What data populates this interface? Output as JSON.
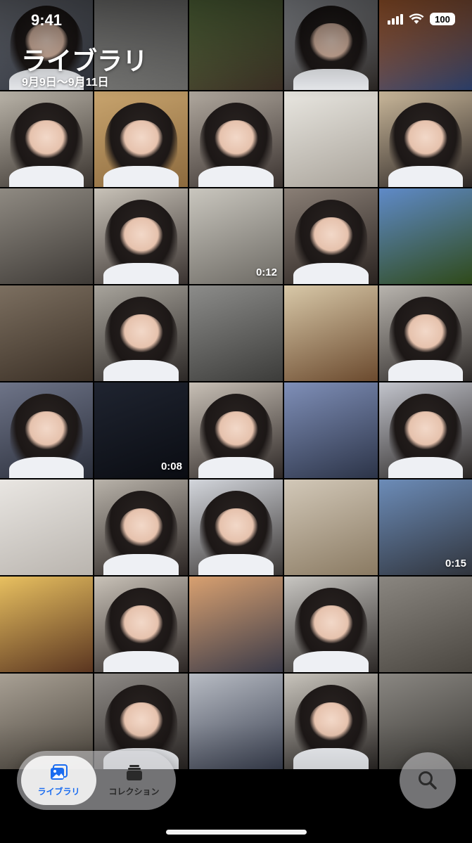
{
  "status_bar": {
    "time": "9:41",
    "battery": "100"
  },
  "header": {
    "title": "ライブラリ",
    "date_range": "9月9日〜9月11日"
  },
  "tiles": [
    {
      "c1": "#8a8f9a",
      "c2": "#2b2f38",
      "p": 1
    },
    {
      "c1": "#9a9a98",
      "c2": "#6b6b69",
      "p": 0
    },
    {
      "c1": "#6f8d4f",
      "c2": "#3b2e24",
      "p": 0
    },
    {
      "c1": "#c7ccd4",
      "c2": "#2a2522",
      "p": 1
    },
    {
      "c1": "#e07a3a",
      "c2": "#2b3f6b",
      "p": 0
    },
    {
      "c1": "#b9b3a8",
      "c2": "#3a342f",
      "p": 1
    },
    {
      "c1": "#c8a46e",
      "c2": "#8c6a3e",
      "p": 1
    },
    {
      "c1": "#b0a89e",
      "c2": "#3b3330",
      "p": 1
    },
    {
      "c1": "#e8e6e0",
      "c2": "#a9a39a",
      "p": 0
    },
    {
      "c1": "#c9b79a",
      "c2": "#2c2624",
      "p": 1
    },
    {
      "c1": "#8f8a82",
      "c2": "#3e3a36",
      "p": 0
    },
    {
      "c1": "#c8c2b8",
      "c2": "#3a3330",
      "p": 1
    },
    {
      "c1": "#c9c6be",
      "c2": "#6d6a64",
      "p": 0
    },
    {
      "c1": "#8a7f76",
      "c2": "#2a2320",
      "p": 1
    },
    {
      "c1": "#5f8ac8",
      "c2": "#2f4a1a",
      "p": 0
    },
    {
      "c1": "#7c6f60",
      "c2": "#3a2f25",
      "p": 0
    },
    {
      "c1": "#a8a49c",
      "c2": "#2c2826",
      "p": 1
    },
    {
      "c1": "#8c8c8a",
      "c2": "#3c3c3a",
      "p": 0
    },
    {
      "c1": "#d8c8a8",
      "c2": "#6b4a2e",
      "p": 0
    },
    {
      "c1": "#b8b4ae",
      "c2": "#2e2a28",
      "p": 1
    },
    {
      "c1": "#6e7488",
      "c2": "#2a2e3a",
      "p": 1
    },
    {
      "c1": "#1f2430",
      "c2": "#0a0c12",
      "p": 0
    },
    {
      "c1": "#c8c0b6",
      "c2": "#2e2826",
      "p": 1
    },
    {
      "c1": "#7f8fb8",
      "c2": "#2c3448",
      "p": 0
    },
    {
      "c1": "#c2c4cc",
      "c2": "#2a2624",
      "p": 1
    },
    {
      "c1": "#e9e6e2",
      "c2": "#b9b4ae",
      "p": 0
    },
    {
      "c1": "#b9b3aa",
      "c2": "#2a2422",
      "p": 1
    },
    {
      "c1": "#d3d6dc",
      "c2": "#3a3634",
      "p": 1
    },
    {
      "c1": "#d2c8b8",
      "c2": "#8a7a62",
      "p": 0
    },
    {
      "c1": "#6c8cb8",
      "c2": "#30343c",
      "p": 0
    },
    {
      "c1": "#e8c060",
      "c2": "#5a3520",
      "p": 0
    },
    {
      "c1": "#c9c2b8",
      "c2": "#2c2624",
      "p": 1
    },
    {
      "c1": "#d8a070",
      "c2": "#3a3a48",
      "p": 0
    },
    {
      "c1": "#c8c6c2",
      "c2": "#2c2826",
      "p": 1
    },
    {
      "c1": "#8a8680",
      "c2": "#4a4640",
      "p": 0
    },
    {
      "c1": "#a8a094",
      "c2": "#4a443c",
      "p": 0
    },
    {
      "c1": "#8e8a86",
      "c2": "#2a2624",
      "p": 1
    },
    {
      "c1": "#b8bcc4",
      "c2": "#3a4050",
      "p": 0
    },
    {
      "c1": "#c8c4bc",
      "c2": "#2a2624",
      "p": 1
    },
    {
      "c1": "#8a8782",
      "c2": "#3a3834",
      "p": 0
    }
  ],
  "durations": {
    "t13": "0:12",
    "t22": "0:08",
    "t30": "0:15"
  },
  "tabbar": {
    "library_label": "ライブラリ",
    "collections_label": "コレクション"
  },
  "colors": {
    "accent": "#1a6cf0"
  }
}
